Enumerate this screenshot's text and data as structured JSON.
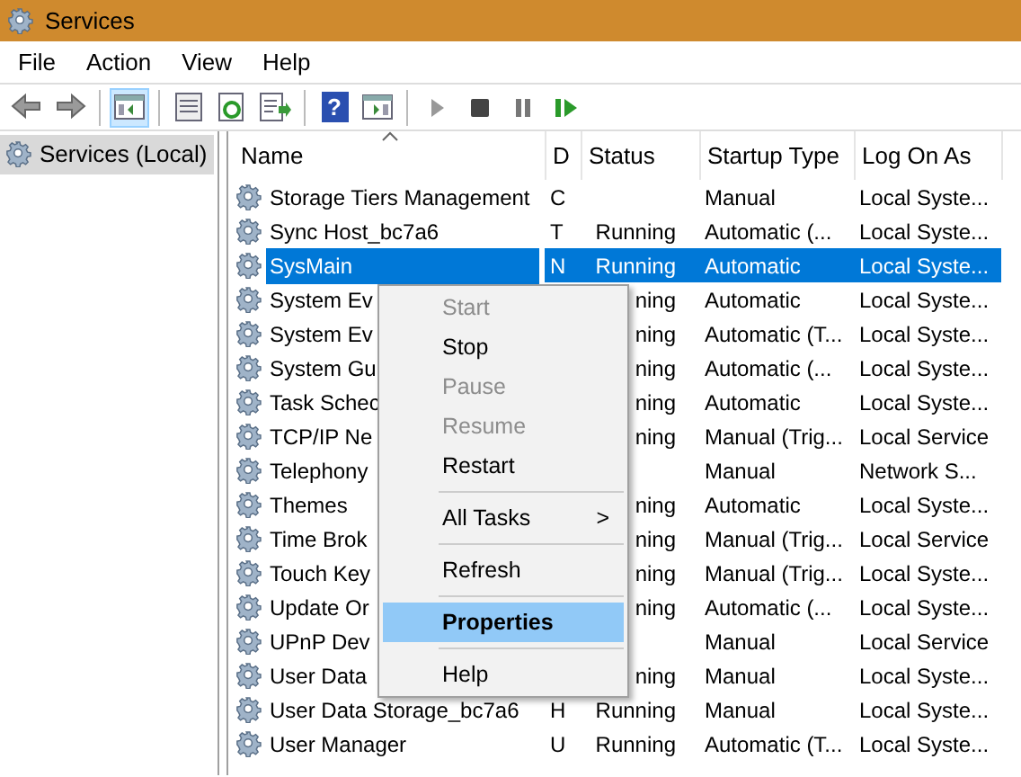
{
  "window": {
    "title": "Services"
  },
  "menu_bar": [
    "File",
    "Action",
    "View",
    "Help"
  ],
  "toolbar": [
    {
      "kind": "back",
      "selected": false
    },
    {
      "kind": "forward",
      "selected": false
    },
    {
      "kind": "sep"
    },
    {
      "kind": "tree",
      "selected": true
    },
    {
      "kind": "sep"
    },
    {
      "kind": "props",
      "selected": false
    },
    {
      "kind": "refresh",
      "selected": false
    },
    {
      "kind": "export",
      "selected": false
    },
    {
      "kind": "sep"
    },
    {
      "kind": "help",
      "glyph": "?",
      "selected": false
    },
    {
      "kind": "pane",
      "selected": false
    },
    {
      "kind": "sep"
    },
    {
      "kind": "play",
      "selected": false
    },
    {
      "kind": "stop",
      "selected": false
    },
    {
      "kind": "pause",
      "selected": false
    },
    {
      "kind": "resume",
      "selected": false
    }
  ],
  "tree": {
    "items": [
      {
        "label": "Services (Local)",
        "selected": true
      }
    ]
  },
  "table": {
    "columns": [
      {
        "label": "Name",
        "sorted": true
      },
      {
        "label": "D",
        "sorted": false
      },
      {
        "label": "Status",
        "sorted": false
      },
      {
        "label": "Startup Type",
        "sorted": false
      },
      {
        "label": "Log On As",
        "sorted": false
      }
    ],
    "rows": [
      {
        "name": "Storage Tiers Management",
        "column_2": "C",
        "startup": "Manual",
        "logon": "Local Syste...",
        "selected": false
      },
      {
        "name": "Sync Host_bc7a6",
        "column_2": "T",
        "status": "Running",
        "startup": "Automatic (...",
        "logon": "Local Syste...",
        "selected": false
      },
      {
        "name": "SysMain",
        "column_2": "N",
        "status": "Running",
        "startup": "Automatic",
        "logon": "Local Syste...",
        "selected": true
      },
      {
        "name": "System Ev",
        "status": "ning",
        "startup": "Automatic",
        "logon": "Local Syste...",
        "selected": false
      },
      {
        "name": "System Ev",
        "status": "ning",
        "startup": "Automatic (T...",
        "logon": "Local Syste...",
        "selected": false
      },
      {
        "name": "System Gu",
        "status": "ning",
        "startup": "Automatic (...",
        "logon": "Local Syste...",
        "selected": false
      },
      {
        "name": "Task Schec",
        "status": "ning",
        "startup": "Automatic",
        "logon": "Local Syste...",
        "selected": false
      },
      {
        "name": "TCP/IP Ne",
        "status": "ning",
        "startup": "Manual (Trig...",
        "logon": "Local Service",
        "selected": false
      },
      {
        "name": "Telephony",
        "startup": "Manual",
        "logon": "Network S...",
        "selected": false
      },
      {
        "name": "Themes",
        "status": "ning",
        "startup": "Automatic",
        "logon": "Local Syste...",
        "selected": false
      },
      {
        "name": "Time Brok",
        "status": "ning",
        "startup": "Manual (Trig...",
        "logon": "Local Service",
        "selected": false
      },
      {
        "name": "Touch Key",
        "status": "ning",
        "startup": "Manual (Trig...",
        "logon": "Local Syste...",
        "selected": false
      },
      {
        "name": "Update Or",
        "status": "ning",
        "startup": "Automatic (...",
        "logon": "Local Syste...",
        "selected": false
      },
      {
        "name": "UPnP Dev",
        "startup": "Manual",
        "logon": "Local Service",
        "selected": false
      },
      {
        "name": "User Data",
        "status": "ning",
        "startup": "Manual",
        "logon": "Local Syste...",
        "selected": false
      },
      {
        "name": "User Data Storage_bc7a6",
        "column_2": "H",
        "status": "Running",
        "startup": "Manual",
        "logon": "Local Syste...",
        "selected": false
      },
      {
        "name": "User Manager",
        "column_2": "U",
        "status": "Running",
        "startup": "Automatic (T...",
        "logon": "Local Syste...",
        "selected": false
      }
    ]
  },
  "context_menu": [
    {
      "kind": "item",
      "label": "Start",
      "disabled": true,
      "selected": false,
      "default": false
    },
    {
      "kind": "item",
      "label": "Stop",
      "disabled": false,
      "selected": false,
      "default": false
    },
    {
      "kind": "item",
      "label": "Pause",
      "disabled": true,
      "selected": false,
      "default": false
    },
    {
      "kind": "item",
      "label": "Resume",
      "disabled": true,
      "selected": false,
      "default": false
    },
    {
      "kind": "item",
      "label": "Restart",
      "disabled": false,
      "selected": false,
      "default": false
    },
    {
      "kind": "separator"
    },
    {
      "kind": "submenu",
      "label": "All Tasks",
      "arrow": ">",
      "disabled": false,
      "selected": false,
      "default": false
    },
    {
      "kind": "separator"
    },
    {
      "kind": "item",
      "label": "Refresh",
      "disabled": false,
      "selected": false,
      "default": false
    },
    {
      "kind": "separator"
    },
    {
      "kind": "item",
      "label": "Properties",
      "disabled": false,
      "selected": true,
      "default": true
    },
    {
      "kind": "separator"
    },
    {
      "kind": "item",
      "label": "Help",
      "disabled": false,
      "selected": false,
      "default": false
    }
  ]
}
